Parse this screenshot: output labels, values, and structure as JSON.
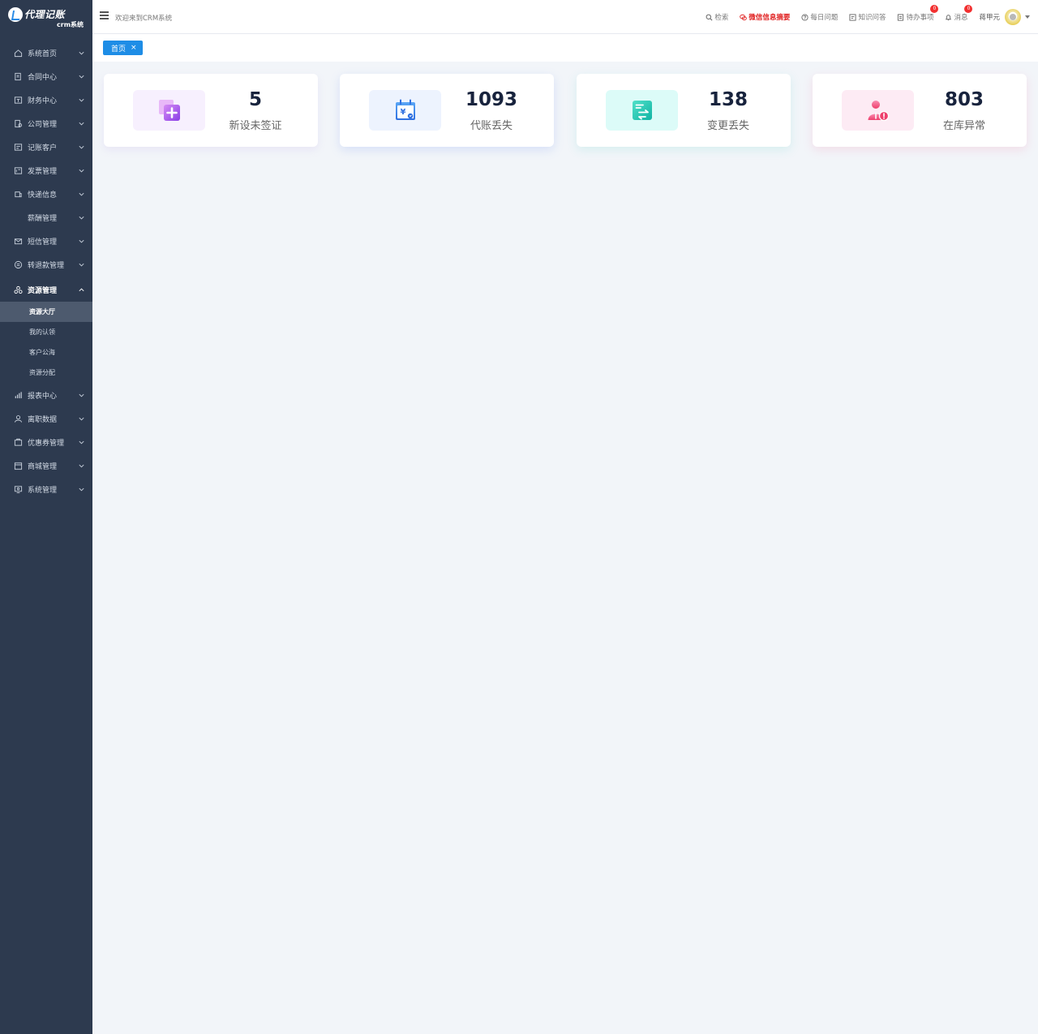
{
  "app": {
    "logo_title": "代理记账",
    "logo_sub": "crm系统"
  },
  "header": {
    "welcome": "欢迎来到CRM系统",
    "links": [
      {
        "label": "检索",
        "icon": "search-icon"
      },
      {
        "label": "微信信息摘要",
        "icon": "wechat-icon",
        "color": "#e02020"
      },
      {
        "label": "每日问题",
        "icon": "question-icon"
      },
      {
        "label": "知识问答",
        "icon": "knowledge-icon"
      },
      {
        "label": "待办事项",
        "icon": "todo-icon",
        "badge": "0"
      },
      {
        "label": "消息",
        "icon": "bell-icon",
        "badge": "0"
      }
    ],
    "user_name": "蒋甲元"
  },
  "sidebar": {
    "items": [
      {
        "label": "系统首页",
        "icon": "home-icon"
      },
      {
        "label": "合同中心",
        "icon": "contract-icon"
      },
      {
        "label": "财务中心",
        "icon": "finance-icon"
      },
      {
        "label": "公司管理",
        "icon": "company-icon"
      },
      {
        "label": "记账客户",
        "icon": "customer-icon"
      },
      {
        "label": "发票管理",
        "icon": "invoice-icon"
      },
      {
        "label": "快递信息",
        "icon": "express-icon"
      },
      {
        "label": "薪酬管理",
        "icon": ""
      },
      {
        "label": "短信管理",
        "icon": "sms-icon"
      },
      {
        "label": "转退款管理",
        "icon": "refund-icon"
      },
      {
        "label": "资源管理",
        "icon": "resource-icon",
        "expanded": true,
        "children": [
          "资源大厅",
          "我的认领",
          "客户公海",
          "资源分配"
        ],
        "active_child": 0
      },
      {
        "label": "报表中心",
        "icon": "report-icon"
      },
      {
        "label": "离职数据",
        "icon": "resign-icon"
      },
      {
        "label": "优惠券管理",
        "icon": "coupon-icon"
      },
      {
        "label": "商城管理",
        "icon": "shop-icon"
      },
      {
        "label": "系统管理",
        "icon": "settings-icon"
      }
    ]
  },
  "tabs": [
    {
      "label": "首页",
      "close": "×"
    }
  ],
  "stats": [
    {
      "value": "5",
      "label": "新设未签证",
      "icon": "new-company-icon",
      "accent": "#a04fe8"
    },
    {
      "value": "1093",
      "label": "代账丢失",
      "icon": "calendar-yuan-icon",
      "accent": "#2f7be8"
    },
    {
      "value": "138",
      "label": "变更丢失",
      "icon": "change-icon",
      "accent": "#17c2b0"
    },
    {
      "value": "803",
      "label": "在库异常",
      "icon": "user-warning-icon",
      "accent": "#f0467a"
    }
  ]
}
